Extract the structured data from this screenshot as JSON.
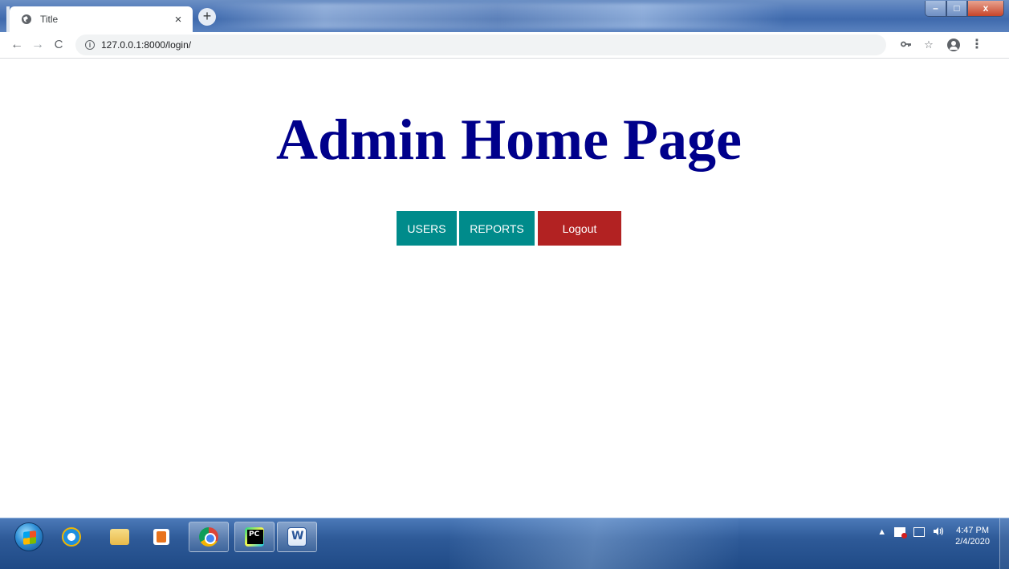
{
  "browser": {
    "tab": {
      "title": "Title",
      "close_glyph": "×"
    },
    "new_tab_glyph": "+",
    "url": "127.0.0.1:8000/login/",
    "nav": {
      "back_glyph": "←",
      "forward_glyph": "→",
      "reload_glyph": "C"
    },
    "window_controls": {
      "minimize": "–",
      "maximize": "□",
      "close": "x"
    }
  },
  "page": {
    "heading": "Admin Home Page",
    "buttons": {
      "users": "USERS",
      "reports": "REPORTS",
      "logout": "Logout"
    },
    "colors": {
      "heading": "#00008b",
      "primary_button": "#008b8b",
      "logout_button": "#b22222"
    }
  },
  "taskbar": {
    "apps": [
      "start-orb",
      "internet-explorer-icon",
      "file-explorer-icon",
      "media-player-icon",
      "chrome-icon",
      "pycharm-icon",
      "word-icon"
    ],
    "clock": {
      "time": "4:47 PM",
      "date": "2/4/2020"
    },
    "tray_arrow": "▲",
    "volume_glyph": "🔊"
  }
}
